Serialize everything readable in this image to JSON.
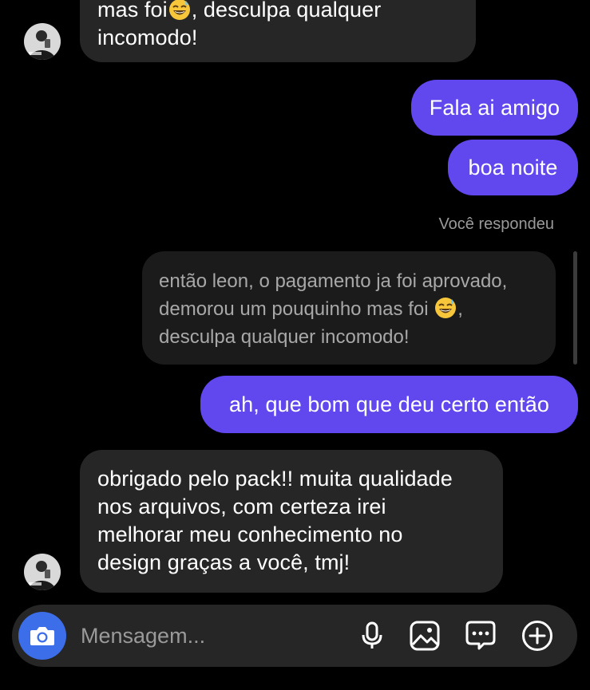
{
  "messages": {
    "top_clipped": {
      "line1_before_emoji": "mas foi",
      "line1_after_emoji": ", desculpa qualquer",
      "line2": "incomodo!"
    },
    "sent_1": "Fala ai amigo",
    "sent_2": "boa noite",
    "reply_label": "Você respondeu",
    "quoted": {
      "line1": "então leon, o pagamento ja foi aprovado,",
      "line2_before_emoji": "demorou um pouquinho mas foi",
      "line2_after_emoji": ",",
      "line3": "desculpa qualquer incomodo!"
    },
    "sent_3": "ah, que bom que deu certo então",
    "received_last": {
      "line1": "obrigado pelo pack!! muita qualidade",
      "line2": "nos arquivos, com certeza irei",
      "line3": "melhorar meu conhecimento no",
      "line4": "design graças a você, tmj!"
    }
  },
  "composer": {
    "placeholder": "Mensagem..."
  },
  "icons": {
    "camera": "camera-icon",
    "mic": "microphone-icon",
    "gallery": "image-icon",
    "sticker": "sticker-chat-icon",
    "add": "plus-circle-icon",
    "emoji": "grinning-sweat-emoji"
  },
  "colors": {
    "background": "#000000",
    "received_bubble": "#262626",
    "sent_bubble": "#6148ee",
    "quoted_bubble": "#1b1b1b",
    "camera_button": "#3d6eea"
  }
}
